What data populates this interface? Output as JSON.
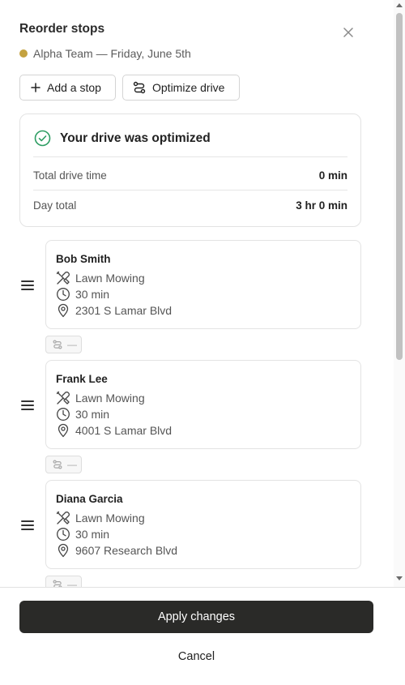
{
  "header": {
    "title": "Reorder stops",
    "subtitle": "Alpha Team — Friday, June 5th",
    "team_color": "#c4a240"
  },
  "toolbar": {
    "add_stop_label": "Add a stop",
    "optimize_label": "Optimize drive"
  },
  "optimization": {
    "heading": "Your drive was optimized",
    "rows": [
      {
        "label": "Total drive time",
        "value": "0 min"
      },
      {
        "label": "Day total",
        "value": "3 hr 0 min"
      }
    ]
  },
  "stops": [
    {
      "name": "Bob Smith",
      "service": "Lawn Mowing",
      "duration": "30 min",
      "address": "2301 S Lamar Blvd",
      "drive_to_next": "—"
    },
    {
      "name": "Frank Lee",
      "service": "Lawn Mowing",
      "duration": "30 min",
      "address": "4001 S Lamar Blvd",
      "drive_to_next": "—"
    },
    {
      "name": "Diana Garcia",
      "service": "Lawn Mowing",
      "duration": "30 min",
      "address": "9607 Research Blvd",
      "drive_to_next": "—"
    }
  ],
  "footer": {
    "apply_label": "Apply changes",
    "cancel_label": "Cancel"
  },
  "icons": {
    "close": "close-icon",
    "add": "plus-icon",
    "optimize": "route-icon",
    "success": "check-circle-icon",
    "drag": "drag-handle-icon",
    "service": "tools-icon",
    "duration": "clock-icon",
    "address": "map-pin-icon"
  },
  "colors": {
    "primary_button": "#2a2a28",
    "success": "#2e9d63",
    "team_dot": "#c4a240"
  }
}
